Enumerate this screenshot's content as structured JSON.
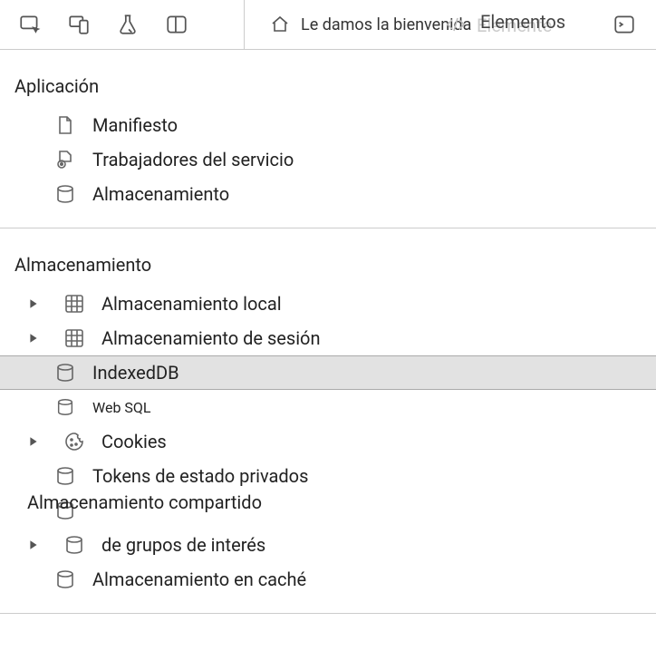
{
  "toolbar": {
    "welcome_label": "Le damos la bienvenida",
    "elements_label": "Elementos",
    "elements_ghost": "Elemente"
  },
  "sections": {
    "application": {
      "title": "Aplicación",
      "items": [
        {
          "label": "Manifiesto"
        },
        {
          "label": "Trabajadores del servicio"
        },
        {
          "label": "Almacenamiento"
        }
      ]
    },
    "storage": {
      "title": "Almacenamiento",
      "items": [
        {
          "label": "Almacenamiento local"
        },
        {
          "label": "Almacenamiento de sesión"
        },
        {
          "label": "IndexedDB"
        },
        {
          "label": "Web SQL"
        },
        {
          "label": "Cookies"
        },
        {
          "label": "Tokens de estado privados"
        },
        {
          "label": "Almacenamiento compartido"
        },
        {
          "label": "de grupos de interés"
        },
        {
          "label": "Almacenamiento en caché"
        }
      ]
    }
  }
}
